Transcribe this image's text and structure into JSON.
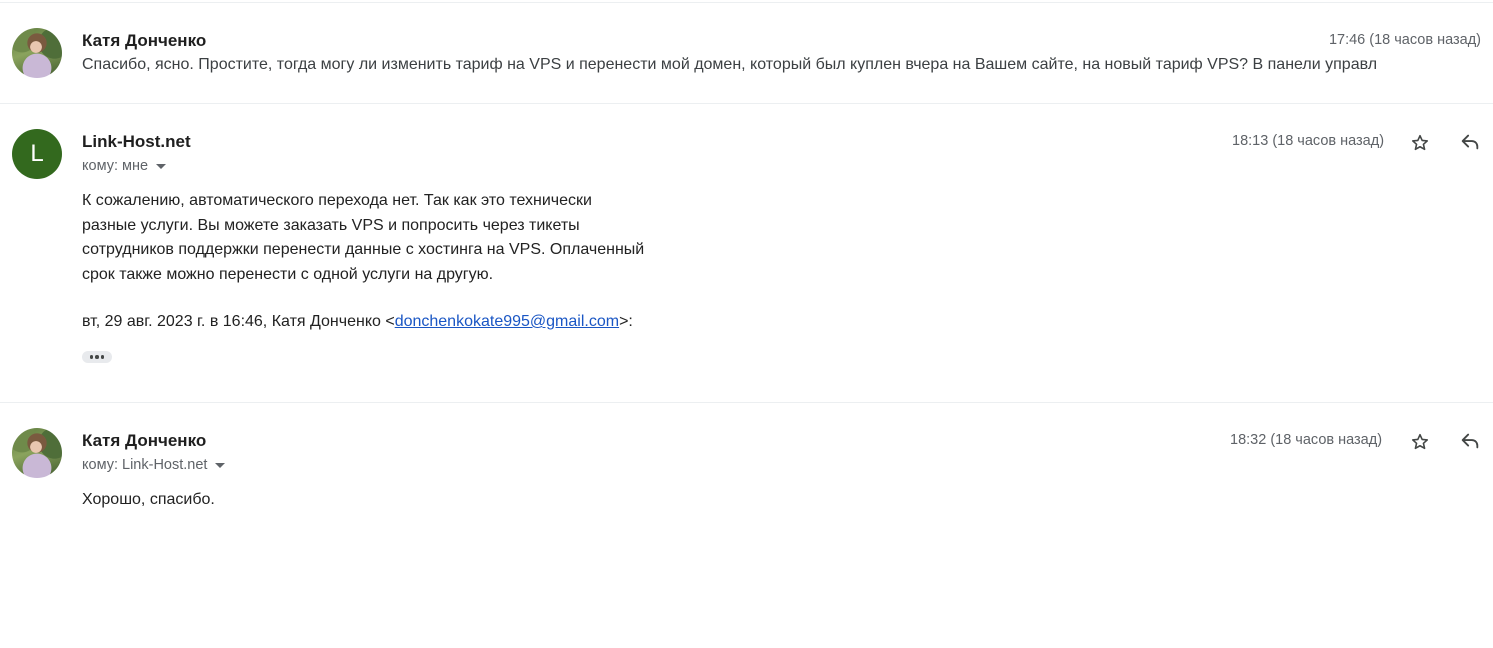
{
  "messages": [
    {
      "sender": "Катя Донченко",
      "time": "17:46 (18 часов назад)",
      "snippet": "Спасибо, ясно. Простите, тогда могу ли изменить тариф на VPS и перенести мой домен, который был куплен вчера на Вашем сайте, на новый тариф VPS? В панели управл"
    },
    {
      "sender": "Link-Host.net",
      "avatar_letter": "L",
      "avatar_color": "#33691e",
      "time": "18:13 (18 часов назад)",
      "recipient": "кому: мне",
      "body_lines": [
        "К сожалению, автоматического перехода нет. Так как это технически",
        "разные услуги. Вы можете заказать VPS  и попросить через тикеты",
        "сотрудников поддержки перенести данные с хостинга на VPS. Оплаченный",
        "срок также можно перенести с одной услуги на другую."
      ],
      "quote_prefix": "вт, 29 авг. 2023 г. в 16:46, Катя Донченко <",
      "quote_email": "donchenkokate995@gmail.com",
      "quote_suffix": ">:"
    },
    {
      "sender": "Катя Донченко",
      "time": "18:32 (18 часов назад)",
      "recipient": "кому: Link-Host.net",
      "body": "Хорошо, спасибо."
    }
  ],
  "icons": {
    "star": "star-icon",
    "reply": "reply-icon",
    "more": "more-horiz-icon",
    "caret": "chevron-down-icon"
  }
}
